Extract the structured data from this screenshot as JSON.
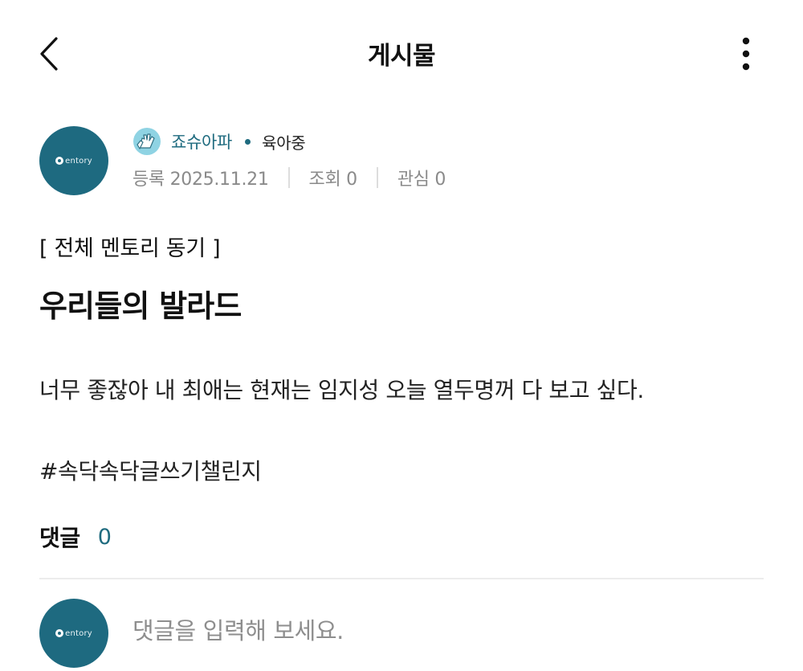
{
  "header": {
    "title": "게시물",
    "back_icon": "chevron-left-icon",
    "more_icon": "more-vertical-icon"
  },
  "author": {
    "avatar_logo": "entory",
    "badge_icon": "hands-badge-icon",
    "name": "죠슈아파",
    "status": "육아중",
    "meta": {
      "registered": "등록 2025.11.21",
      "views": "조회 0",
      "interest": "관심 0"
    }
  },
  "post": {
    "category": "[ 전체 멘토리 동기 ]",
    "title": "우리들의 발라드",
    "body": "너무 좋잖아 내 최애는 현재는 임지성 오늘 열두명꺼 다 보고 싶다.",
    "hashtag": "#속닥속닥글쓰기챌린지"
  },
  "comments": {
    "label": "댓글",
    "count": "0",
    "input_placeholder": "댓글을 입력해 보세요."
  },
  "colors": {
    "accent": "#1f6b7f",
    "avatar_bg": "#1e6a80",
    "meta_text": "#8a8a8a",
    "divider": "#ececec"
  }
}
